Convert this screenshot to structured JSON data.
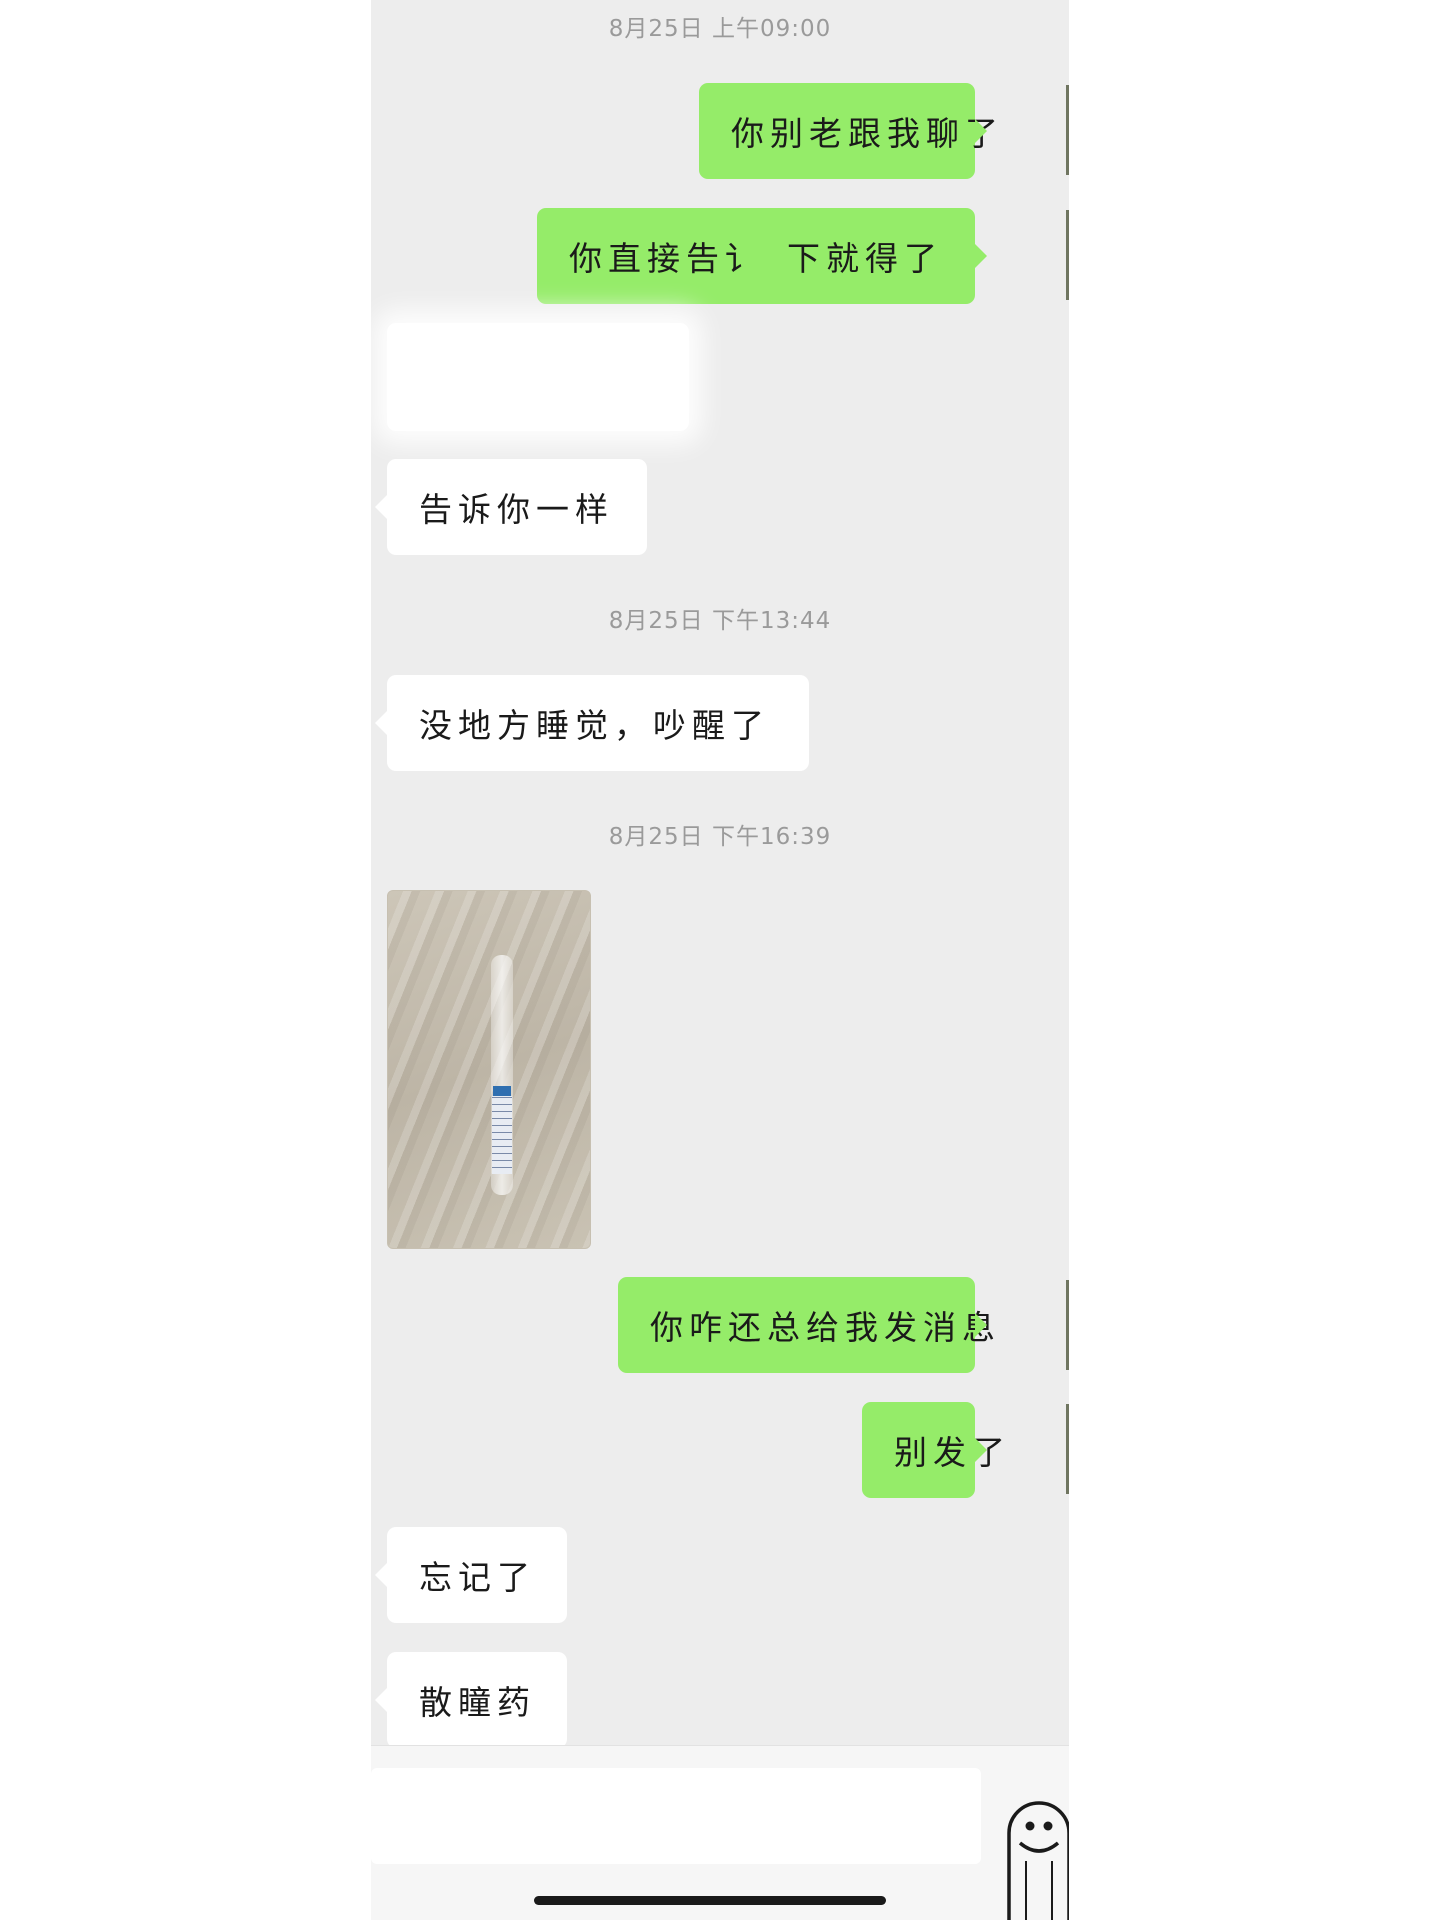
{
  "timestamps": [
    "8月25日 上午09:00",
    "8月25日 下午13:44",
    "8月25日 下午16:39"
  ],
  "messages": {
    "m1": "你别老跟我聊了",
    "m2a": "你直接告讠",
    "m2b": "下就得了",
    "m3": "告诉你一样",
    "m4": "没地方睡觉，吵醒了",
    "m5": "你咋还总给我发消息",
    "m6": "别发了",
    "m7": "忘记了",
    "m8": "散瞳药"
  },
  "colors": {
    "sent_bubble": "#95ec69",
    "received_bubble": "#ffffff",
    "chat_bg": "#ededed"
  },
  "icons": {
    "emoji": "emoji-face-icon"
  }
}
